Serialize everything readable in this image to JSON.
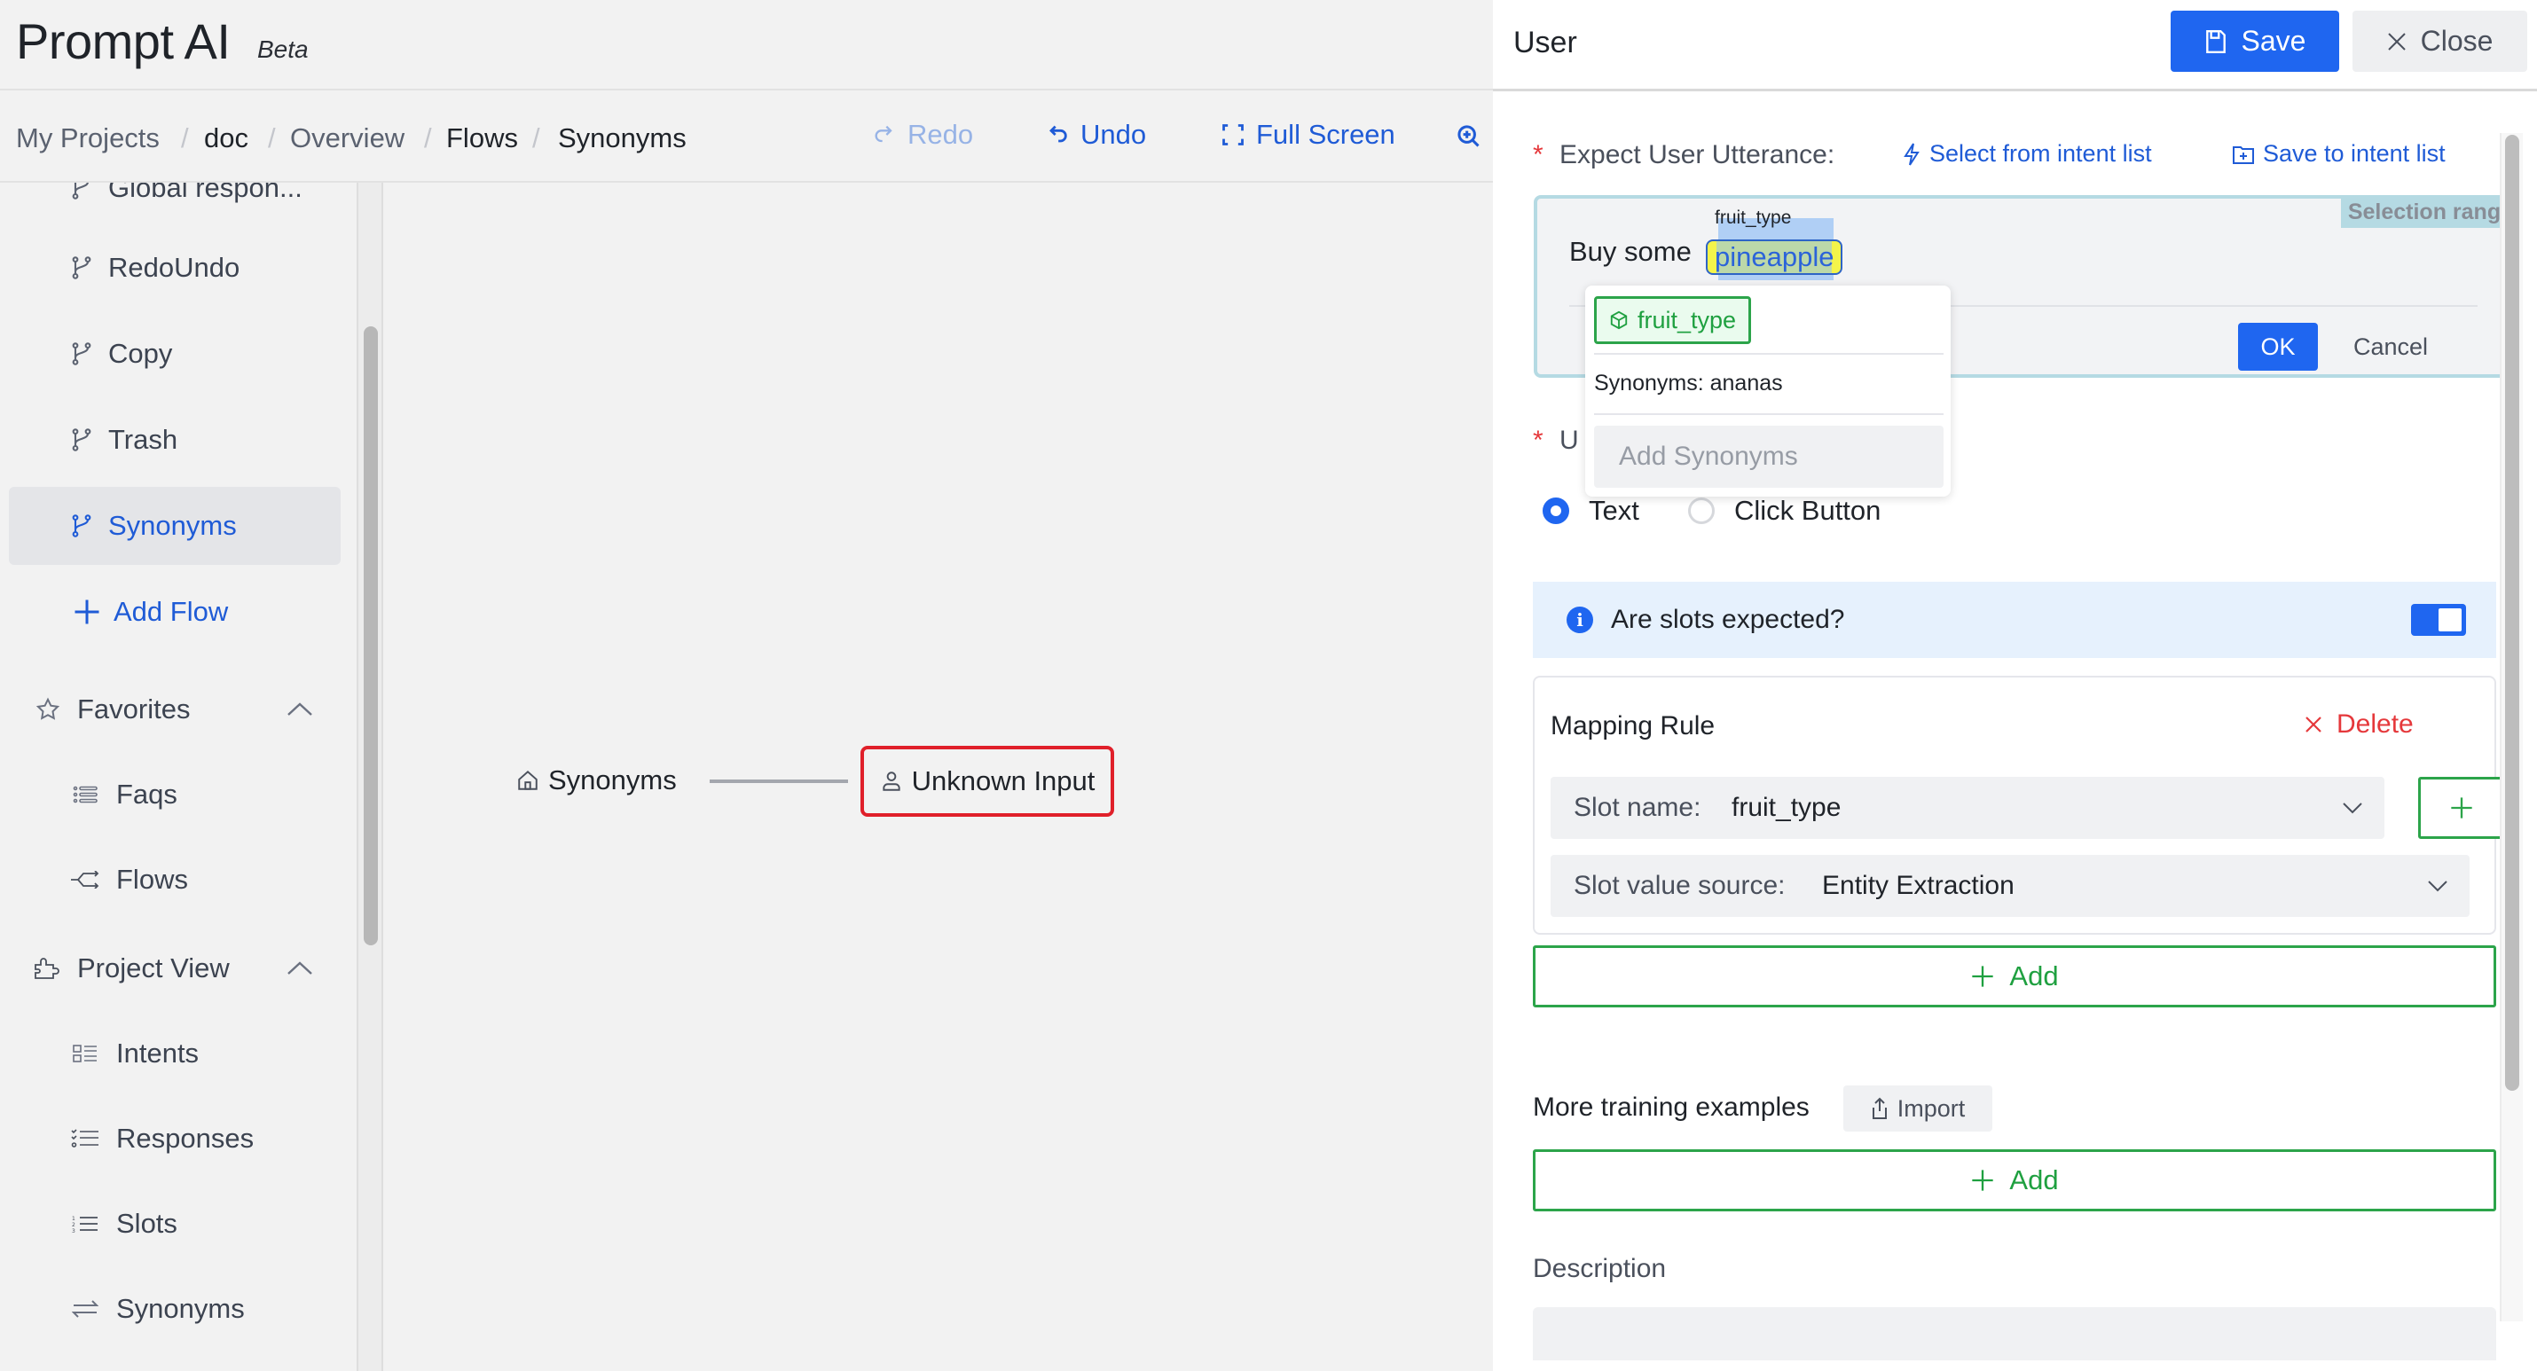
{
  "app": {
    "title": "Prompt AI",
    "badge": "Beta"
  },
  "breadcrumb": {
    "items": [
      "My Projects",
      "doc",
      "Overview",
      "Flows",
      "Synonyms"
    ],
    "separator": "/"
  },
  "toolbar": {
    "redo_label": "Redo",
    "undo_label": "Undo",
    "fullscreen_label": "Full Screen",
    "redo_disabled": true
  },
  "sidebar": {
    "flows": [
      {
        "label": "Global respon...",
        "icon": "branch-icon"
      },
      {
        "label": "RedoUndo",
        "icon": "branch-icon"
      },
      {
        "label": "Copy",
        "icon": "branch-icon"
      },
      {
        "label": "Trash",
        "icon": "branch-icon"
      },
      {
        "label": "Synonyms",
        "icon": "branch-icon",
        "active": true
      }
    ],
    "add_flow_label": "Add Flow",
    "favorites": {
      "label": "Favorites",
      "expanded": true,
      "items": [
        {
          "label": "Faqs",
          "icon": "list-icon"
        },
        {
          "label": "Flows",
          "icon": "flows-icon"
        }
      ]
    },
    "project_view": {
      "label": "Project View",
      "expanded": true,
      "items": [
        {
          "label": "Intents",
          "icon": "intents-icon"
        },
        {
          "label": "Responses",
          "icon": "checklist-icon"
        },
        {
          "label": "Slots",
          "icon": "numbered-list-icon"
        },
        {
          "label": "Synonyms",
          "icon": "swap-icon"
        }
      ]
    }
  },
  "canvas": {
    "start_node": "Synonyms",
    "user_node": "Unknown Input"
  },
  "panel": {
    "title": "User",
    "save_label": "Save",
    "close_label": "Close",
    "utterance": {
      "required_mark": "*",
      "label": "Expect User Utterance:",
      "select_link": "Select from intent list",
      "save_link": "Save to intent list",
      "selection_range_label": "Selection range",
      "text_before": "Buy some",
      "entity_value": "pineapple",
      "entity_name": "fruit_type",
      "ok_label": "OK",
      "cancel_label": "Cancel"
    },
    "popover": {
      "entity_tag": "fruit_type",
      "synonyms_text": "Synonyms: ananas",
      "add_placeholder": "Add Synonyms"
    },
    "user_type": {
      "required_mark": "*",
      "label_visible": "U",
      "options": [
        {
          "label": "Text",
          "selected": true
        },
        {
          "label": "Click Button",
          "selected": false
        }
      ]
    },
    "slots_banner": {
      "text": "Are slots expected?",
      "enabled": true
    },
    "mapping_rule": {
      "title": "Mapping Rule",
      "delete_label": "Delete",
      "slot_name_label": "Slot name:",
      "slot_name_value": "fruit_type",
      "slot_source_label": "Slot value source:",
      "slot_source_value": "Entity Extraction"
    },
    "add_label": "Add",
    "more_examples_label": "More training examples",
    "import_label": "Import",
    "description_label": "Description"
  },
  "colors": {
    "primary": "#1f66f0",
    "link": "#1f5bd6",
    "success": "#2ca44a",
    "danger": "#e5383b",
    "node_border": "#e0202a"
  }
}
